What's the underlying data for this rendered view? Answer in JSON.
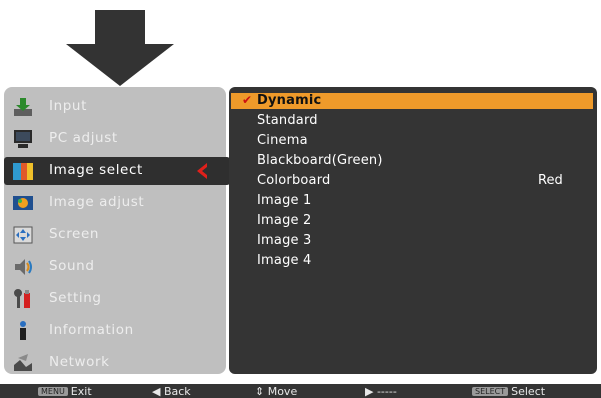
{
  "menu": {
    "items": [
      {
        "label": "Input",
        "icon": "input-icon"
      },
      {
        "label": "PC adjust",
        "icon": "pc-adjust-icon"
      },
      {
        "label": "Image select",
        "icon": "image-select-icon",
        "selected": true
      },
      {
        "label": "Image adjust",
        "icon": "image-adjust-icon"
      },
      {
        "label": "Screen",
        "icon": "screen-icon"
      },
      {
        "label": "Sound",
        "icon": "sound-icon"
      },
      {
        "label": "Setting",
        "icon": "setting-icon"
      },
      {
        "label": "Information",
        "icon": "information-icon"
      },
      {
        "label": "Network",
        "icon": "network-icon"
      }
    ]
  },
  "options": {
    "items": [
      {
        "label": "Dynamic",
        "active": true,
        "checked": true
      },
      {
        "label": "Standard"
      },
      {
        "label": "Cinema"
      },
      {
        "label": "Blackboard(Green)"
      },
      {
        "label": "Colorboard",
        "value": "Red"
      },
      {
        "label": "Image 1"
      },
      {
        "label": "Image 2"
      },
      {
        "label": "Image 3"
      },
      {
        "label": "Image 4"
      }
    ],
    "check_mark": "✔"
  },
  "help_bar": {
    "exit_key": "MENU",
    "exit_label": "Exit",
    "back_label": "◀ Back",
    "move_label": "⇕ Move",
    "next_label": "▶ -----",
    "select_key": "SELECT",
    "select_label": "Select"
  },
  "colors": {
    "highlight": "#ef9a2a",
    "menu_panel": "#bfbfbf",
    "options_panel": "#343434",
    "selected_row": "#2f2f2f",
    "chevron": "#e0201b"
  }
}
